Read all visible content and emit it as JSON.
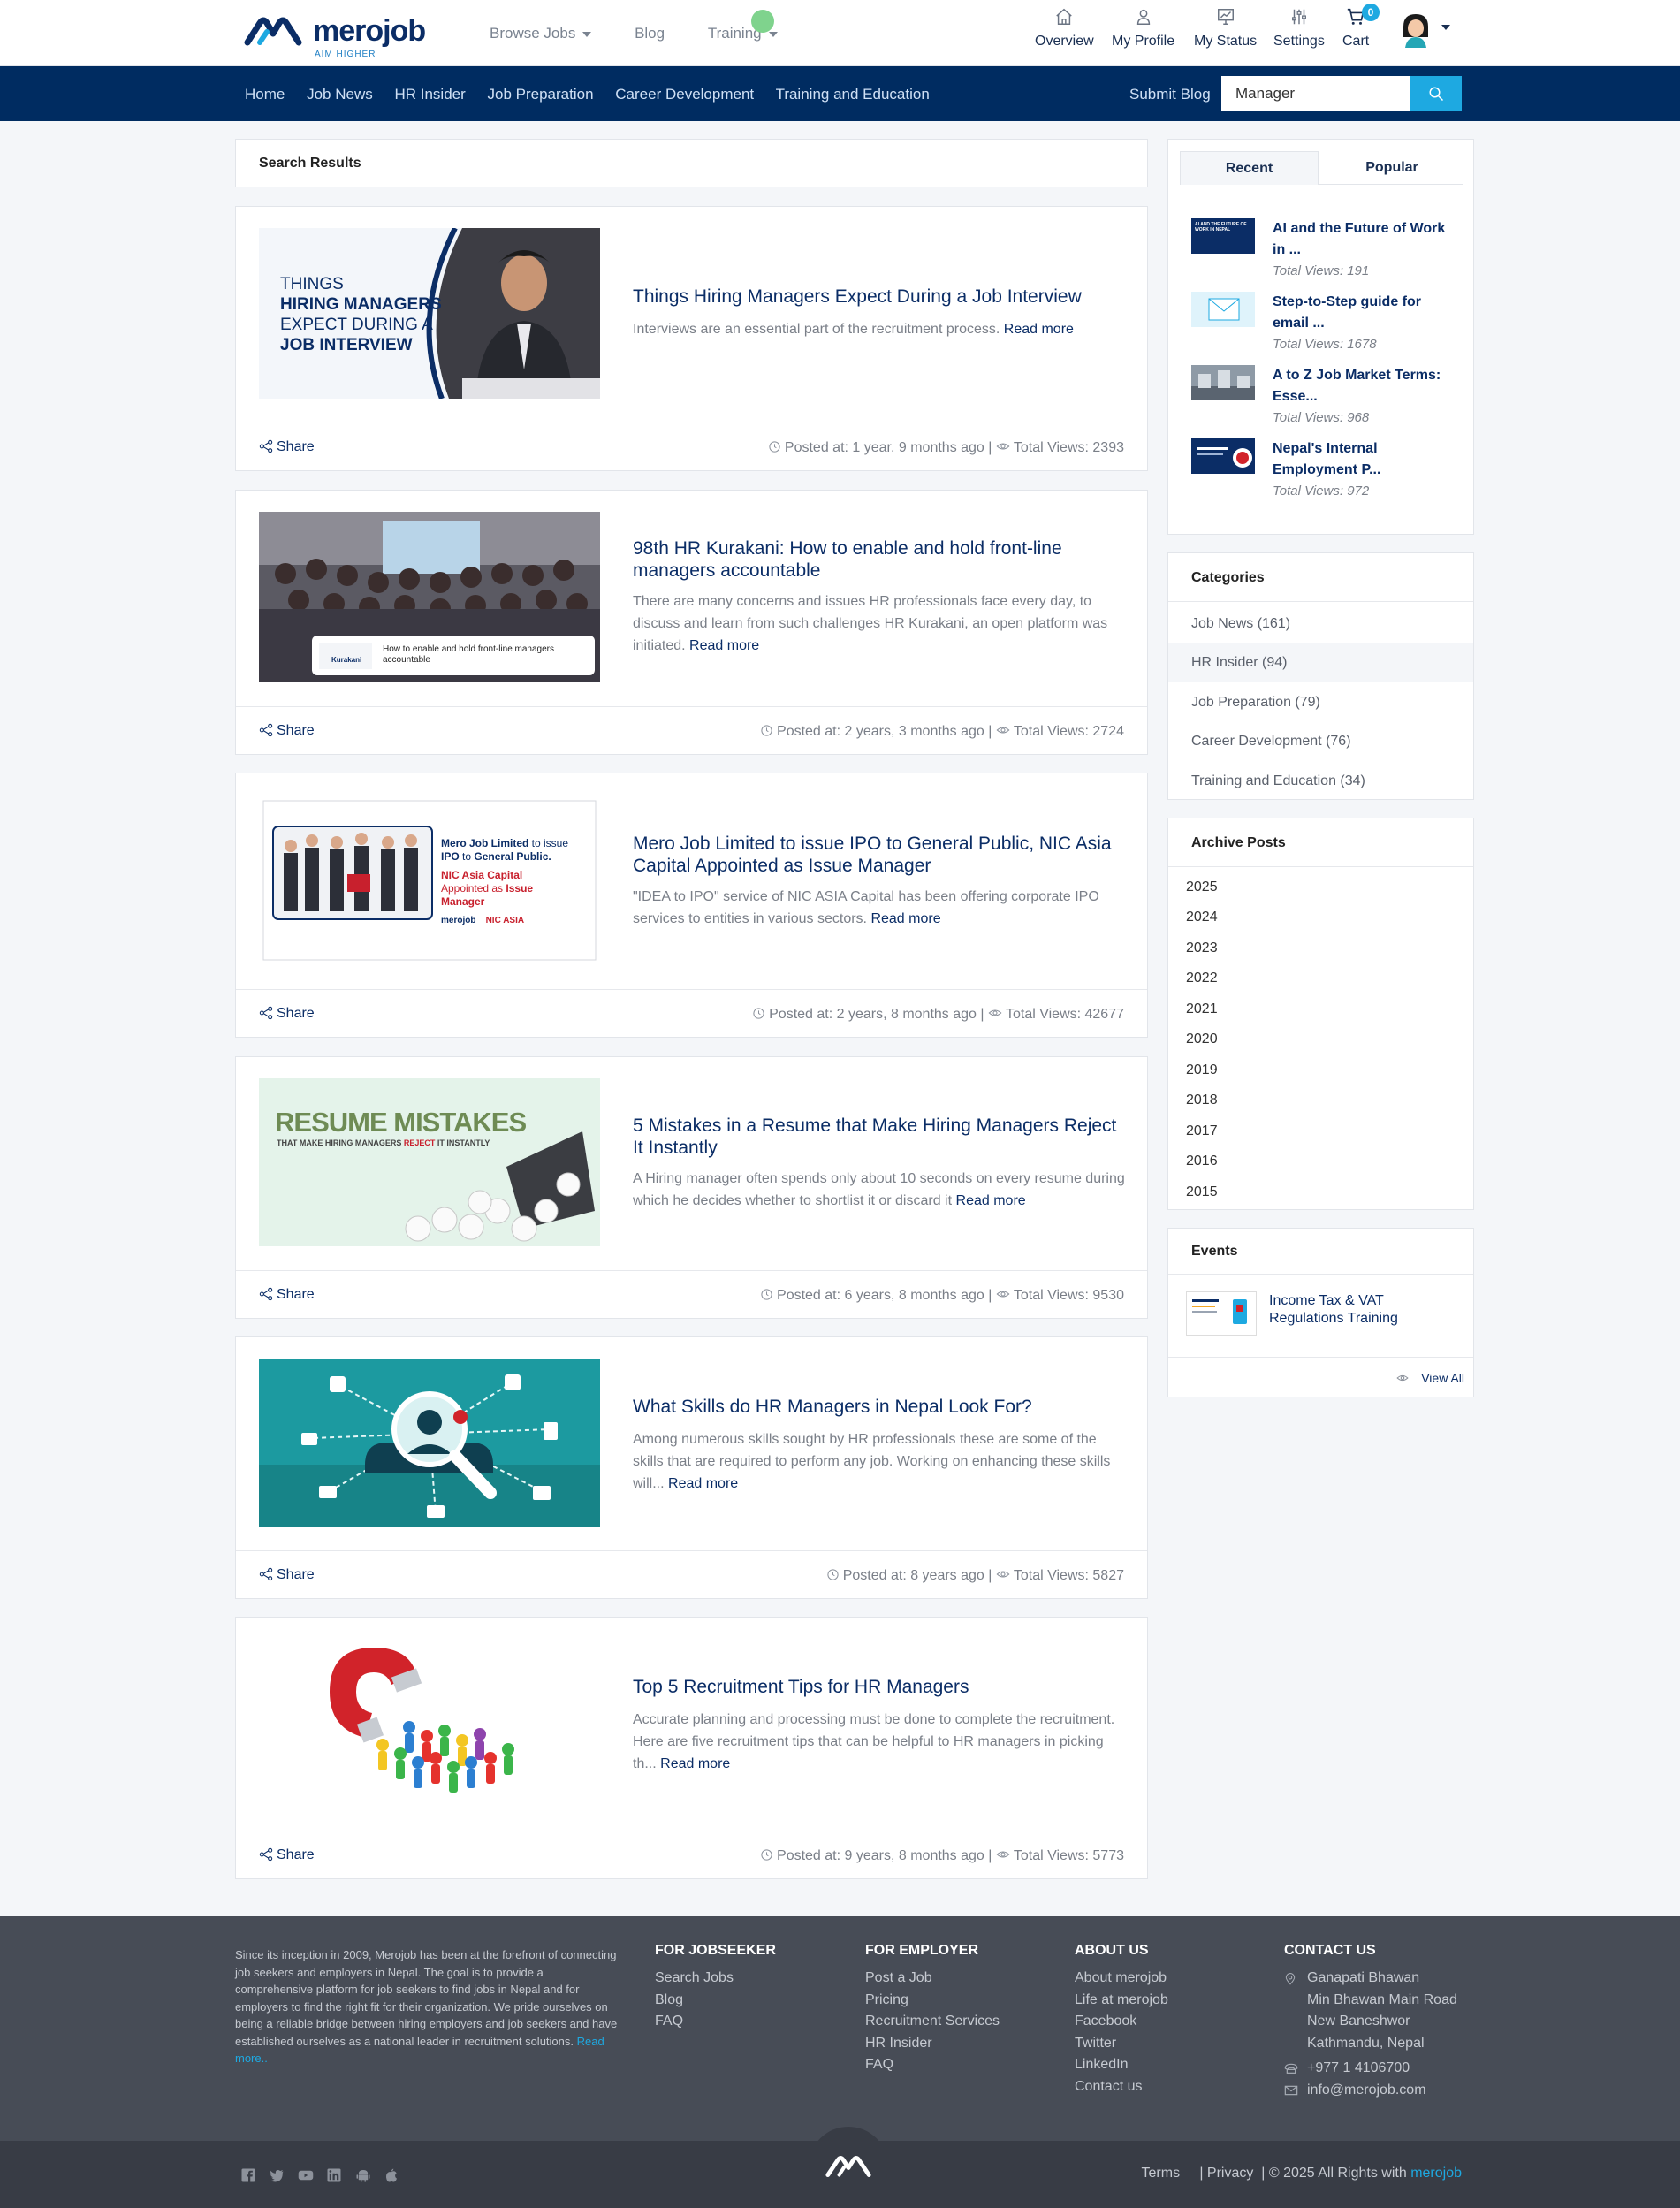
{
  "header": {
    "logo_text": "merojob",
    "logo_tagline": "AIM HIGHER",
    "nav": [
      {
        "label": "Browse Jobs",
        "dropdown": true
      },
      {
        "label": "Blog",
        "dropdown": false
      },
      {
        "label": "Training",
        "dropdown": true
      }
    ],
    "user_menu": [
      {
        "label": "Overview",
        "icon": "home-icon"
      },
      {
        "label": "My Profile",
        "icon": "user-icon"
      },
      {
        "label": "My Status",
        "icon": "chart-icon"
      },
      {
        "label": "Settings",
        "icon": "sliders-icon"
      },
      {
        "label": "Cart",
        "icon": "cart-icon"
      }
    ],
    "cart_count": "0"
  },
  "subnav": {
    "links": [
      "Home",
      "Job News",
      "HR Insider",
      "Job Preparation",
      "Career Development",
      "Training and Education"
    ],
    "submit_blog": "Submit Blog",
    "search_value": "Manager"
  },
  "search_results_title": "Search Results",
  "posts": [
    {
      "title": "Things Hiring Managers Expect During a Job Interview",
      "excerpt": "Interviews are an essential part of the recruitment process.",
      "read_more": "Read more",
      "share": "Share",
      "posted": "Posted at: 1 year, 9 months ago",
      "views": "Total Views: 2393",
      "thumb": {
        "line1": "THINGS",
        "line2": "HIRING MANAGERS",
        "line3": "EXPECT DURING A",
        "line4": "JOB INTERVIEW"
      }
    },
    {
      "title": "98th HR Kurakani: How to enable and hold front-line managers accountable",
      "excerpt": "There are many concerns and issues HR professionals face every day, to discuss and learn from such challenges HR Kurakani, an open platform was initiated.",
      "read_more": "Read more",
      "share": "Share",
      "posted": "Posted at: 2 years, 3 months ago",
      "views": "Total Views: 2724",
      "thumb": {
        "caption": "How to enable and hold front-line managers accountable",
        "badge": "Kurakani"
      }
    },
    {
      "title": "Mero Job Limited to issue IPO to General Public, NIC Asia Capital Appointed as Issue Manager",
      "excerpt": "\"IDEA to IPO\" service of NIC ASIA Capital has been offering corporate IPO services to entities in various sectors.",
      "read_more": "Read more",
      "share": "Share",
      "posted": "Posted at: 2 years, 8 months ago",
      "views": "Total Views: 42677",
      "thumb": {
        "l1a": "Mero Job Limited",
        "l1b": " to issue",
        "l2a": "IPO",
        "l2b": " to ",
        "l2c": "General Public.",
        "l3": "NIC Asia Capital",
        "l4a": "Appointed as ",
        "l4b": "Issue",
        "l5": "Manager",
        "brand1": "merojob",
        "brand2": "NIC ASIA"
      }
    },
    {
      "title": "5 Mistakes in a Resume that Make Hiring Managers Reject It Instantly",
      "excerpt": "A Hiring manager often spends only about 10 seconds on every resume during which he decides whether to shortlist it or discard it",
      "read_more": "Read more",
      "share": "Share",
      "posted": "Posted at: 6 years, 8 months ago",
      "views": "Total Views: 9530",
      "thumb": {
        "headline": "RESUME MISTAKES",
        "sub_a": "THAT MAKE HIRING MANAGERS ",
        "sub_b": "REJECT",
        "sub_c": " IT INSTANTLY"
      }
    },
    {
      "title": "What Skills do HR Managers in Nepal Look For?",
      "excerpt": "Among numerous skills sought by HR professionals these are some of the skills that are required to perform any job. Working on enhancing these skills will...",
      "read_more": "Read more",
      "share": "Share",
      "posted": "Posted at: 8 years ago",
      "views": "Total Views: 5827",
      "thumb": {}
    },
    {
      "title": "Top 5 Recruitment Tips for HR Managers",
      "excerpt": "Accurate planning and processing must be done to complete the recruitment. Here are five recruitment tips that can be helpful to HR managers in picking th...",
      "read_more": "Read more",
      "share": "Share",
      "posted": "Posted at: 9 years, 8 months ago",
      "views": "Total Views: 5773",
      "thumb": {}
    }
  ],
  "sidebar": {
    "tabs": [
      "Recent",
      "Popular"
    ],
    "recent": [
      {
        "title": "AI and the Future of Work in ...",
        "views": "Total Views: 191",
        "thumb_text": "AI AND THE FUTURE OF WORK IN NEPAL"
      },
      {
        "title": "Step-to-Step guide for email ...",
        "views": "Total Views: 1678"
      },
      {
        "title": "A to Z Job Market Terms: Esse...",
        "views": "Total Views: 968"
      },
      {
        "title": "Nepal's Internal Employment P...",
        "views": "Total Views: 972"
      }
    ],
    "categories_title": "Categories",
    "categories": [
      "Job News (161)",
      "HR Insider (94)",
      "Job Preparation (79)",
      "Career Development (76)",
      "Training and Education (34)"
    ],
    "archive_title": "Archive Posts",
    "archive_years": [
      "2025",
      "2024",
      "2023",
      "2022",
      "2021",
      "2020",
      "2019",
      "2018",
      "2017",
      "2016",
      "2015"
    ],
    "events_title": "Events",
    "event": "Income Tax & VAT Regulations Training",
    "view_all": "View All"
  },
  "footer": {
    "about": "Since its inception in 2009, Merojob has been at the forefront of connecting job seekers and employers in Nepal. The goal is to provide a comprehensive platform for job seekers to find jobs in Nepal and for employers to find the right fit for their organization. We pride ourselves on being a reliable bridge between hiring employers and job seekers and have established ourselves as a national leader in recruitment solutions.",
    "about_more": "Read more..",
    "columns": [
      {
        "title": "FOR JOBSEEKER",
        "links": [
          "Search Jobs",
          "Blog",
          "FAQ"
        ]
      },
      {
        "title": "FOR EMPLOYER",
        "links": [
          "Post a Job",
          "Pricing",
          "Recruitment Services",
          "HR Insider",
          "FAQ"
        ]
      },
      {
        "title": "ABOUT US",
        "links": [
          "About merojob",
          "Life at merojob",
          "Facebook",
          "Twitter",
          "LinkedIn",
          "Contact us"
        ]
      }
    ],
    "contact_title": "CONTACT US",
    "address": [
      "Ganapati Bhawan",
      "Min Bhawan Main Road",
      "New Baneshwor",
      "Kathmandu, Nepal"
    ],
    "phone": "+977 1 4106700",
    "email": "info@merojob.com",
    "terms": "Terms",
    "privacy": "| Privacy",
    "copyright": "| © 2025 All Rights with",
    "brand": "merojob"
  },
  "colors": {
    "navy": "#002c61",
    "accent": "#1ea9e1",
    "footer": "#474c56"
  }
}
